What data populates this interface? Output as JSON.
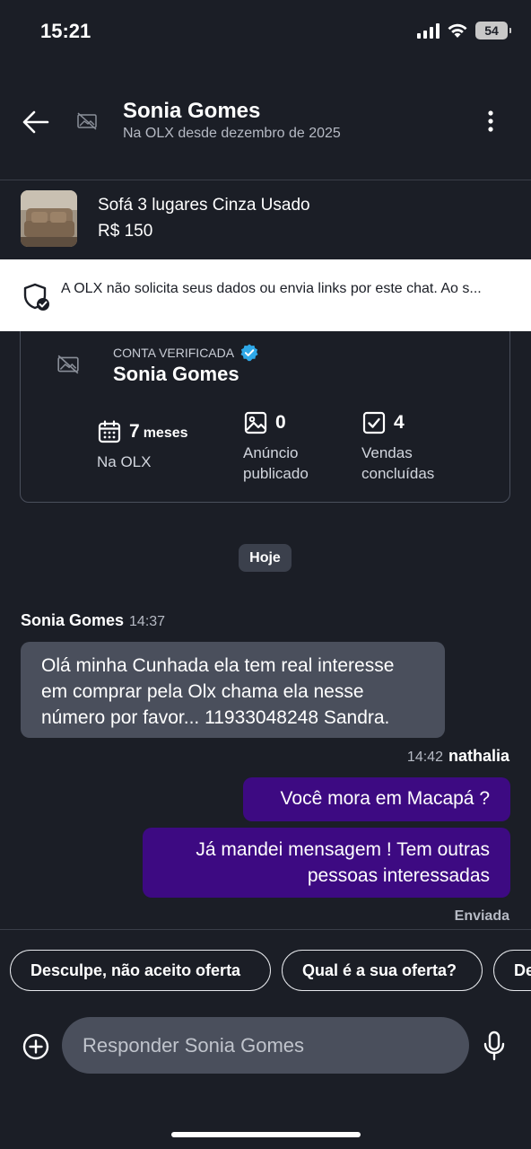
{
  "status_bar": {
    "time": "15:21",
    "battery": "54"
  },
  "header": {
    "name": "Sonia Gomes",
    "subtitle": "Na OLX desde dezembro de 2025"
  },
  "listing": {
    "title": "Sofá 3 lugares Cinza Usado",
    "price": "R$ 150"
  },
  "safety_banner": {
    "text": "A OLX não solicita seus dados ou envia links por este chat. Ao s..."
  },
  "profile_card": {
    "verified_label": "CONTA VERIFICADA",
    "name": "Sonia Gomes",
    "stats": [
      {
        "value": "7",
        "unit": "meses",
        "label": "Na OLX"
      },
      {
        "value": "0",
        "label": "Anúncio publicado"
      },
      {
        "value": "4",
        "label": "Vendas concluídas"
      }
    ]
  },
  "chat": {
    "date_chip": "Hoje",
    "incoming": {
      "sender": "Sonia Gomes",
      "time": "14:37",
      "text": "Olá minha Cunhada ela tem real interesse em comprar pela Olx chama ela nesse número por favor...  11933048248 Sandra."
    },
    "outgoing": {
      "time": "14:42",
      "sender": "nathalia",
      "messages": [
        "Você mora em Macapá ?",
        "Já mandei mensagem ! Tem outras pessoas interessadas"
      ],
      "status": "Enviada"
    }
  },
  "quick_replies": [
    "Desculpe, não aceito oferta",
    "Qual é a sua oferta?",
    "De"
  ],
  "composer": {
    "placeholder": "Responder Sonia Gomes"
  },
  "colors": {
    "background": "#1b1e26",
    "incoming_bubble": "#4a4f5c",
    "outgoing_bubble": "#3d0a82",
    "verified_badge": "#2ea8e8"
  },
  "icons": [
    "back-arrow-icon",
    "image-placeholder-icon",
    "more-vertical-icon",
    "shield-check-icon",
    "verified-badge-icon",
    "calendar-icon",
    "image-icon",
    "checkbox-icon",
    "add-circle-icon",
    "microphone-icon"
  ]
}
